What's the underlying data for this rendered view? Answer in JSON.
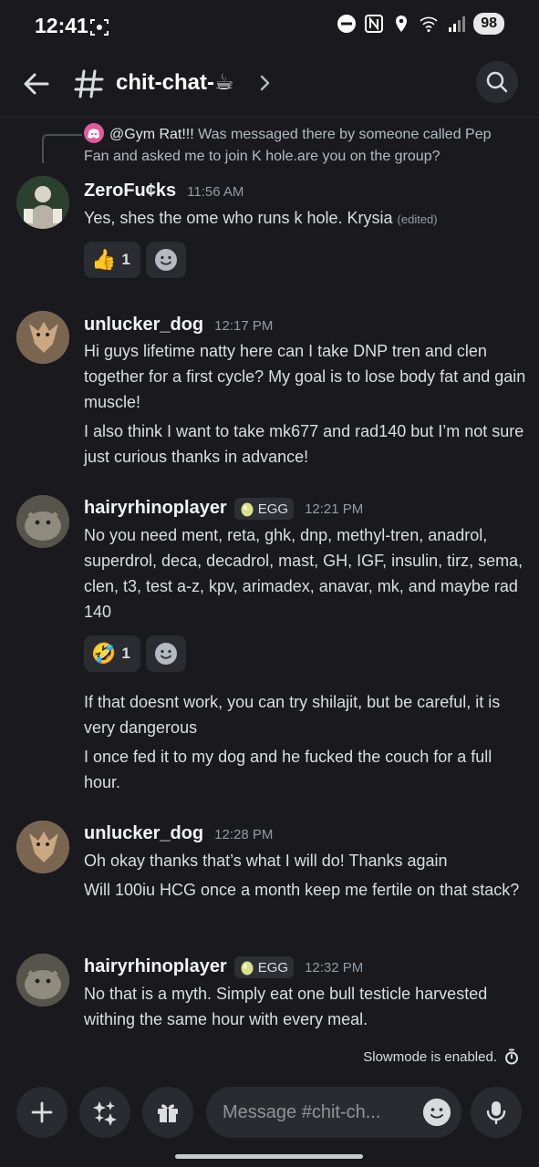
{
  "status_bar": {
    "time": "12:41",
    "battery": "98",
    "icons": [
      "screenshot-icon",
      "do-not-disturb-icon",
      "nfc-icon",
      "location-icon",
      "wifi-icon",
      "signal-icon"
    ]
  },
  "header": {
    "channel_name": "chit-chat-☕",
    "icons": [
      "back-arrow-icon",
      "hash-icon",
      "chevron-right-icon",
      "search-icon"
    ]
  },
  "reply": {
    "mention": "@Gym Rat!!!",
    "text": " Was messaged there by someone called Pep Fan and asked me to join K hole.are you on the group?"
  },
  "messages": [
    {
      "username": "ZeroFu¢ks",
      "time": "11:56 AM",
      "lines": [
        "Yes, shes the ome who runs k hole. Krysia"
      ],
      "edited": "(edited)",
      "reaction": {
        "emoji": "👍",
        "count": "1"
      }
    },
    {
      "username": "unlucker_dog",
      "time": "12:17 PM",
      "lines": [
        "Hi guys lifetime natty here can I take DNP tren and clen together for a first cycle? My goal is to lose body fat and gain muscle!",
        "I also think I want to take mk677 and rad140 but I’m not sure just curious thanks in advance!"
      ]
    },
    {
      "username": "hairyrhinoplayer",
      "tag": "EGG",
      "time": "12:21 PM",
      "lines": [
        "No you need ment, reta, ghk, dnp, methyl-tren, anadrol, superdrol, deca, decadrol, mast, GH, IGF, insulin, tirz, sema, clen, t3, test a-z, kpv, arimadex, anavar, mk, and maybe rad 140",
        "If that doesnt work, you can try shilajit, but be careful, it is very dangerous",
        "I once fed it to my dog and he fucked the couch for a full hour."
      ],
      "reaction": {
        "emoji": "🤣",
        "count": "1"
      }
    },
    {
      "username": "unlucker_dog",
      "time": "12:28 PM",
      "lines": [
        "Oh okay thanks that’s what I will do! Thanks again",
        "Will 100iu HCG once a month keep me fertile on that stack?"
      ]
    },
    {
      "username": "hairyrhinoplayer",
      "tag": "EGG",
      "time": "12:32 PM",
      "lines": [
        "No that is a myth. Simply eat one bull testicle harvested withing the same hour with every meal."
      ]
    }
  ],
  "slowmode": "Slowmode is enabled.",
  "composer": {
    "placeholder": "Message #chit-ch..."
  },
  "colors": {
    "background": "#1a1a1e",
    "text": "#dbdee1",
    "muted": "#949ba4",
    "surface": "#2a2b30"
  }
}
